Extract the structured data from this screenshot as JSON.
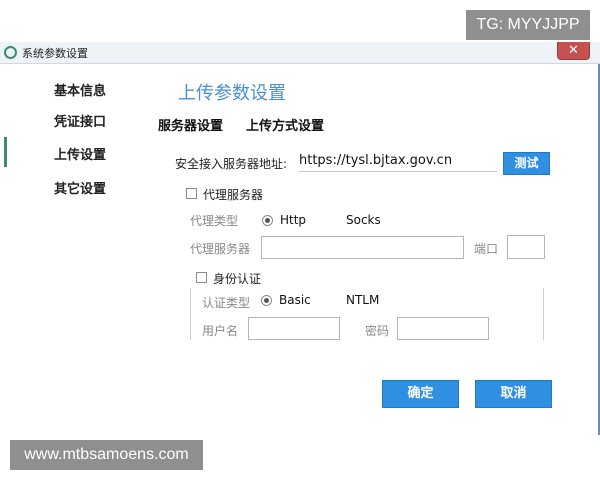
{
  "watermarks": {
    "top": "TG: MYYJJPP",
    "bottom": "www.mtbsamoens.com"
  },
  "window": {
    "title": "系统参数设置",
    "close_icon": "close-icon"
  },
  "sidebar": {
    "items": [
      {
        "label": "基本信息"
      },
      {
        "label": "凭证接口"
      },
      {
        "label": "上传设置"
      },
      {
        "label": "其它设置"
      }
    ]
  },
  "panel": {
    "title": "上传参数设置",
    "tabs": [
      {
        "label": "服务器设置"
      },
      {
        "label": "上传方式设置"
      }
    ]
  },
  "server": {
    "url_label": "安全接入服务器地址:",
    "url_value": "https://tysl.bjtax.gov.cn",
    "test_button": "测试"
  },
  "proxy": {
    "checkbox_label": "代理服务器",
    "type_label": "代理类型",
    "option_http": "Http",
    "option_socks": "Socks",
    "server_label": "代理服务器",
    "port_label": "端口"
  },
  "auth": {
    "checkbox_label": "身份认证",
    "type_label": "认证类型",
    "option_basic": "Basic",
    "option_ntlm": "NTLM",
    "username_label": "用户名",
    "password_label": "密码"
  },
  "actions": {
    "ok": "确定",
    "cancel": "取消"
  }
}
